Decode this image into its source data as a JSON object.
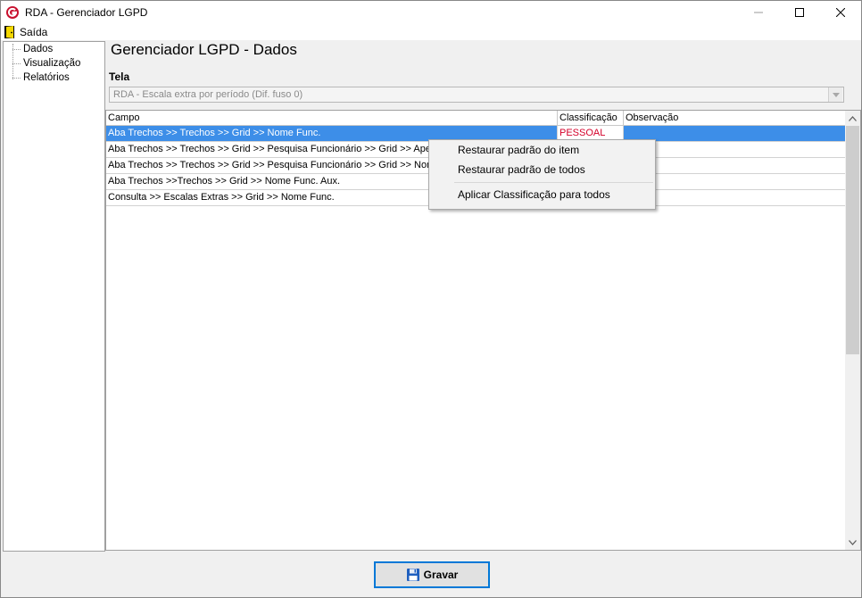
{
  "window": {
    "title": "RDA - Gerenciador LGPD",
    "controls": {
      "minimize": "—",
      "maximize": "☐",
      "close": "✕"
    }
  },
  "menu": {
    "exit_label": "Saída",
    "exit_icon": "door-exit-icon"
  },
  "sidebar": {
    "items": [
      {
        "label": "Dados"
      },
      {
        "label": "Visualização"
      },
      {
        "label": "Relatórios"
      }
    ]
  },
  "main": {
    "title": "Gerenciador LGPD - Dados",
    "tela_label": "Tela",
    "tela_value": "RDA - Escala extra por período (Dif. fuso 0)"
  },
  "grid": {
    "columns": [
      "Campo",
      "Classificação",
      "Observação"
    ],
    "rows": [
      {
        "campo": "Aba Trechos >> Trechos >> Grid >> Nome Func.",
        "classificacao": "PESSOAL",
        "observacao": ""
      },
      {
        "campo": "Aba Trechos >> Trechos >> Grid >> Pesquisa Funcionário >> Grid >> Apelido",
        "classificacao": "",
        "observacao": ""
      },
      {
        "campo": "Aba Trechos >> Trechos >> Grid >> Pesquisa Funcionário >> Grid >> Nome",
        "classificacao": "",
        "observacao": ""
      },
      {
        "campo": "Aba Trechos >>Trechos >> Grid >> Nome Func. Aux.",
        "classificacao": "",
        "observacao": ""
      },
      {
        "campo": "Consulta >> Escalas Extras >> Grid >> Nome Func.",
        "classificacao": "",
        "observacao": ""
      }
    ],
    "selected_row": 0
  },
  "context_menu": {
    "items": [
      "Restaurar padrão do item",
      "Restaurar padrão de todos",
      "Aplicar Classificação para todos"
    ]
  },
  "footer": {
    "save_label": "Gravar",
    "save_icon": "floppy-disk-icon"
  },
  "colors": {
    "selection": "#3d8ee8",
    "classification_text": "#d4002a",
    "focus_border": "#0078d7"
  }
}
